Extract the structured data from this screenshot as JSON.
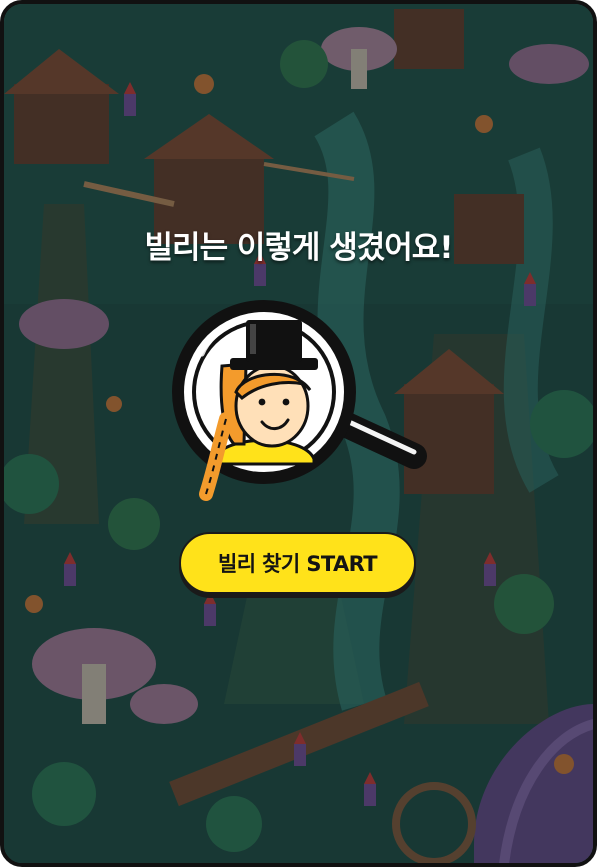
{
  "screen": {
    "headline": "빌리는 이렇게 생겼어요!",
    "start_button_label": "빌리 찾기 START"
  },
  "illustration": {
    "character": "Billy",
    "icon": "magnifying-glass-icon",
    "background": "busy forest village of gnomes, tree houses and mushrooms (dimmed)"
  },
  "colors": {
    "frame_border": "#111111",
    "button_fill": "#ffe21a",
    "headline_text": "#ffffff",
    "background_tone": "#1f4a45"
  }
}
